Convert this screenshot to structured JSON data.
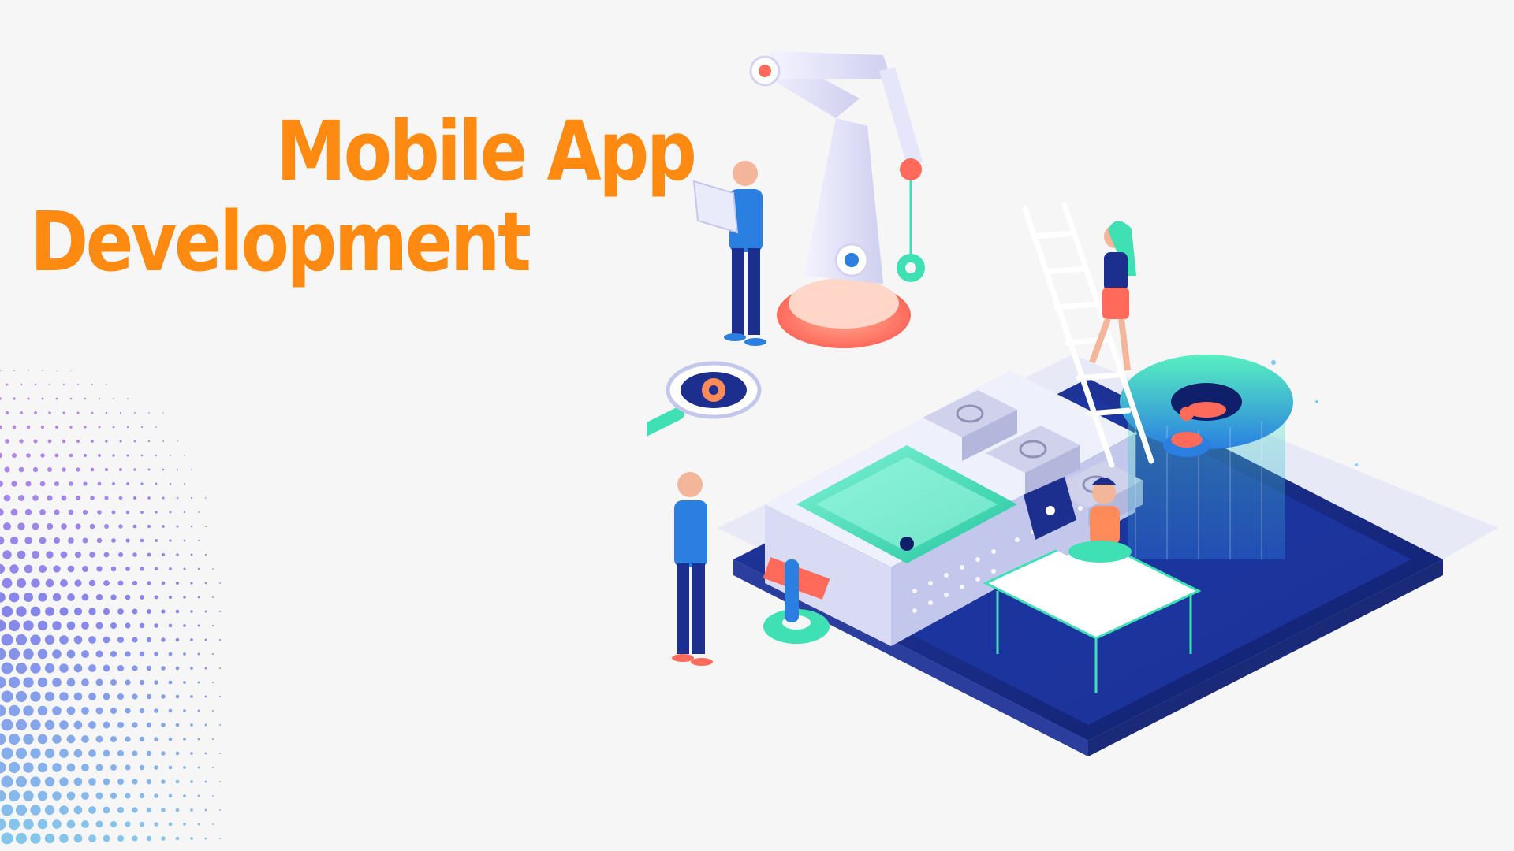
{
  "banner": {
    "title_line1": "Mobile App",
    "title_line2": "Development"
  },
  "colors": {
    "accent": "#ff8a12",
    "background": "#f6f6f7",
    "navy": "#1c2f8e",
    "mint": "#3ee0b4",
    "coral": "#ff6a5a"
  },
  "illustration": {
    "icons": [
      "robotic-arm",
      "smartphone",
      "gear",
      "magnifier",
      "ladder",
      "laptop",
      "desk",
      "people"
    ]
  }
}
